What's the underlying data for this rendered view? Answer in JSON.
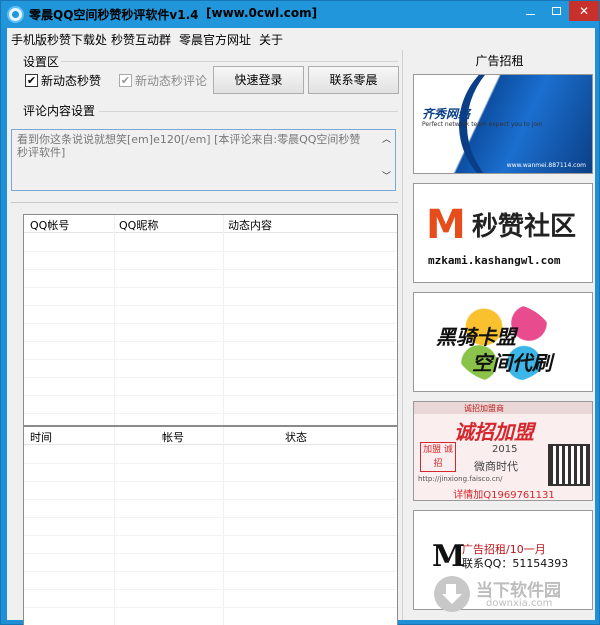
{
  "window": {
    "title": "零晨QQ空间秒赞秒评软件v1.4",
    "url": "[www.0cwl.com]"
  },
  "menu": [
    "手机版秒赞下载处",
    "秒赞互动群",
    "零晨官方网址",
    "关于"
  ],
  "settings": {
    "section_label": "设置区",
    "new_like_label": "新动态秒赞",
    "new_like_checked": true,
    "new_comment_label": "新动态秒评论",
    "new_comment_checked": true,
    "new_comment_disabled": true,
    "quick_login_label": "快速登录",
    "contact_label": "联系零晨"
  },
  "comment": {
    "section_label": "评论内容设置",
    "content": "看到你这条说说就想笑[em]e120[/em]        [本评论来自:零晨QQ空间秒赞秒评软件]"
  },
  "accounts_table": {
    "columns": [
      "QQ帐号",
      "QQ昵称",
      "动态内容"
    ],
    "rows": []
  },
  "log_table": {
    "columns": [
      "时间",
      "帐号",
      "状态"
    ],
    "rows": []
  },
  "ads": {
    "title": "广告招租",
    "ad1": {
      "logo": "齐秀网络",
      "tagline": "Perfect network team expect you to join",
      "url": "www.wanmei.887114.com"
    },
    "ad2": {
      "logo": "M",
      "name": "秒赞社区",
      "url": "mzkami.kashangwl.com"
    },
    "ad3": {
      "line1": "黑骑卡盟",
      "line2": "空间代刷"
    },
    "ad4": {
      "banner": "诚招加盟商",
      "big": "诚招加盟",
      "seal": "加盟 诚招",
      "year": "2015",
      "sub": "微商时代",
      "site": "http://jinxiong.faisco.cn/",
      "contact": "详情加Q1969761131"
    },
    "ad5": {
      "logo": "M",
      "line1": "广告招租/10一月",
      "line2": "联系QQ：51154393"
    }
  },
  "watermark": {
    "name": "当下软件园",
    "url": "downxia.com"
  },
  "colors": {
    "title_bar": "#2196db",
    "close_button": "#c7302b",
    "panel": "#f0f0f0"
  }
}
